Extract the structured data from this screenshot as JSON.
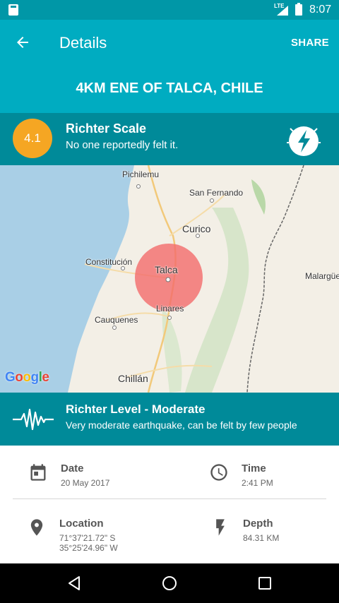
{
  "status_bar": {
    "network": "LTE",
    "time": "8:07",
    "icons": [
      "sd-card-icon",
      "signal-icon",
      "battery-icon"
    ]
  },
  "app_bar": {
    "title": "Details",
    "share_label": "SHARE",
    "place": "4KM ENE OF TALCA, CHILE",
    "back_icon": "arrow-left-icon",
    "color": "#00acc1"
  },
  "magnitude": {
    "value": "4.1",
    "scale_title": "Richter Scale",
    "felt_text": "No one reportedly felt it.",
    "badge_color": "#f5a623",
    "icon": "lightning-bolt-icon"
  },
  "map": {
    "labels": {
      "pichilemu": "Pichilemu",
      "san_fernando": "San Fernando",
      "curico": "Curico",
      "constitucion": "Constitución",
      "talca": "Talca",
      "linares": "Linares",
      "cauquenes": "Cauquenes",
      "malargue": "Malargüe",
      "chillan": "Chillán"
    },
    "attribution": "Google",
    "marker_color": "#f36c6c"
  },
  "level": {
    "title": "Richter Level - Moderate",
    "description": "Very moderate earthquake, can be felt by few people",
    "icon": "seismograph-wave-icon"
  },
  "details": {
    "date": {
      "label": "Date",
      "value": "20 May 2017",
      "icon": "calendar-icon"
    },
    "time": {
      "label": "Time",
      "value": "2:41 PM",
      "icon": "clock-icon"
    },
    "location": {
      "label": "Location",
      "lat": "71°37'21.72\" S",
      "lon": "35°25'24.96\" W",
      "icon": "location-pin-icon"
    },
    "depth": {
      "label": "Depth",
      "value": "84.31 KM",
      "icon": "bolt-icon"
    }
  },
  "nav_bar": {
    "icons": [
      "back-triangle-icon",
      "home-circle-icon",
      "recents-square-icon"
    ]
  }
}
